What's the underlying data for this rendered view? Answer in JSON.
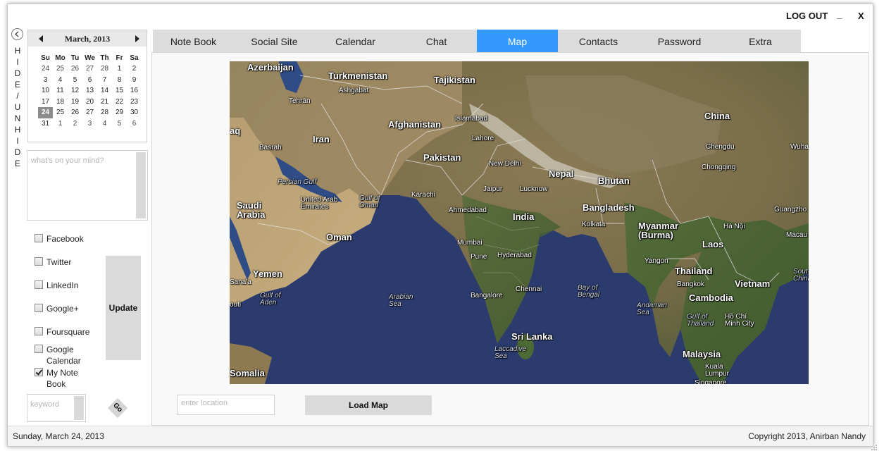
{
  "window": {
    "logout_label": "LOG OUT",
    "minimize_label": "_",
    "close_label": "X"
  },
  "sidebar": {
    "hide_unhide_letters": [
      "H",
      "I",
      "D",
      "E",
      "/",
      "U",
      "N",
      "H",
      "I",
      "D",
      "E"
    ],
    "calendar": {
      "title": "March, 2013",
      "weekdays": [
        "Su",
        "Mo",
        "Tu",
        "We",
        "Th",
        "Fr",
        "Sa"
      ],
      "weeks": [
        [
          "24",
          "25",
          "26",
          "27",
          "28",
          "1",
          "2"
        ],
        [
          "3",
          "4",
          "5",
          "6",
          "7",
          "8",
          "9"
        ],
        [
          "10",
          "11",
          "12",
          "13",
          "14",
          "15",
          "16"
        ],
        [
          "17",
          "18",
          "19",
          "20",
          "21",
          "22",
          "23"
        ],
        [
          "24",
          "25",
          "26",
          "27",
          "28",
          "29",
          "30"
        ],
        [
          "31",
          "1",
          "2",
          "3",
          "4",
          "5",
          "6"
        ]
      ],
      "selected_day": "24"
    },
    "status_placeholder": "what's on your mind?",
    "networks": [
      {
        "label": "Facebook",
        "checked": false
      },
      {
        "label": "Twitter",
        "checked": false
      },
      {
        "label": "LinkedIn",
        "checked": false
      },
      {
        "label": "Google+",
        "checked": false
      },
      {
        "label": "Foursquare",
        "checked": false
      },
      {
        "label": "Google\nCalendar",
        "checked": false
      },
      {
        "label": "My Note\nBook",
        "checked": true
      }
    ],
    "update_label": "Update",
    "keyword_placeholder": "keyword",
    "go_label": "Go"
  },
  "tabs": [
    {
      "label": "Note Book",
      "active": false
    },
    {
      "label": "Social Site",
      "active": false
    },
    {
      "label": "Calendar",
      "active": false
    },
    {
      "label": "Chat",
      "active": false
    },
    {
      "label": "Map",
      "active": true
    },
    {
      "label": "Contacts",
      "active": false
    },
    {
      "label": "Password",
      "active": false
    },
    {
      "label": "Extra",
      "active": false
    }
  ],
  "map": {
    "labels": {
      "azerbaijan": "Azerbaijan",
      "turkmenistan": "Turkmenistan",
      "ashgabat": "Ashgabat",
      "tajikistan": "Tajikistan",
      "tehran": "Tehrān",
      "iraq": "aq",
      "iran": "Iran",
      "afghanistan": "Afghanistan",
      "islamabad": "Islamabad",
      "china": "China",
      "chengdu": "Chengdu",
      "wuhan": "Wuha",
      "chongqing": "Chongqing",
      "basrah": "Basrah",
      "lahore": "Lahore",
      "pakistan": "Pakistan",
      "newdelhi": "New Delhi",
      "nepal": "Nepal",
      "bhutan": "Bhutan",
      "persiangulf": "Persian Gulf",
      "jaipur": "Jaipur",
      "lucknow": "Lucknow",
      "karachi": "Karachi",
      "uae": "United Arab\nEmirates",
      "gulfoman": "Gulf of\nOman",
      "saudi": "Saudi\nArabia",
      "bangladesh": "Bangladesh",
      "guangzhou": "Guangzho",
      "ahmedabad": "Ahmedabad",
      "india": "India",
      "myanmar": "Myanmar\n(Burma)",
      "kolkata": "Kolkata",
      "hanoi": "Hà Nội",
      "oman": "Oman",
      "mumbai": "Mumbai",
      "macau": "Macau",
      "laos": "Laos",
      "pune": "Pune",
      "hyderabad": "Hyderabad",
      "yemen": "Yemen",
      "yangon": "Yangon",
      "thailand": "Thailand",
      "sanaa": "Sana'a",
      "bangkok": "Bangkok",
      "southchina": "Sout\nChina",
      "vietnam": "Vietnam",
      "gulfaden": "Gulf of\nAden",
      "chennai": "Chennai",
      "bayofbengal": "Bay of\nBengal",
      "arabiansea": "Arabian\nSea",
      "bangalore": "Bangalore",
      "cambodia": "Cambodia",
      "outi": "outi",
      "andaman": "Andaman\nSea",
      "gulfthailand": "Gulf of\nThailand",
      "hochiminh": "Hồ Chí\nMinh City",
      "srilanka": "Sri Lanka",
      "laccadive": "Laccadive\nSea",
      "malaysia": "Malaysia",
      "kualalumpur": "Kuala\nLumpur",
      "somalia": "Somalia",
      "singapore": "Singapore"
    }
  },
  "location_placeholder": "enter location",
  "load_map_label": "Load Map",
  "footer": {
    "date": "Sunday, March 24, 2013",
    "copyright": "Copyright 2013, Anirban Nandy"
  },
  "colors": {
    "active_tab": "#3399ff",
    "tab_bg": "#dcdcdc",
    "button_bg": "#dadada",
    "calendar_today": "#8c8c8c"
  }
}
